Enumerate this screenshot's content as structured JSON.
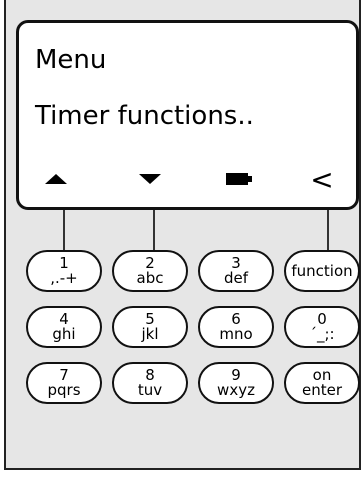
{
  "display": {
    "line1": "Menu",
    "line2": "Timer functions..",
    "softkeys": {
      "up_icon": "triangle-up-icon",
      "down_icon": "triangle-down-icon",
      "battery_icon": "battery-icon",
      "back_label": "<"
    }
  },
  "keypad": {
    "rows": [
      [
        {
          "num": "1",
          "sub": ",.-+"
        },
        {
          "num": "2",
          "sub": "abc"
        },
        {
          "num": "3",
          "sub": "def"
        },
        {
          "label": "function"
        }
      ],
      [
        {
          "num": "4",
          "sub": "ghi"
        },
        {
          "num": "5",
          "sub": "jkl"
        },
        {
          "num": "6",
          "sub": "mno"
        },
        {
          "num": "0",
          "sub": "´_;:"
        }
      ],
      [
        {
          "num": "7",
          "sub": "pqrs"
        },
        {
          "num": "8",
          "sub": "tuv"
        },
        {
          "num": "9",
          "sub": "wxyz"
        },
        {
          "num": "on",
          "sub": "enter"
        }
      ]
    ]
  }
}
